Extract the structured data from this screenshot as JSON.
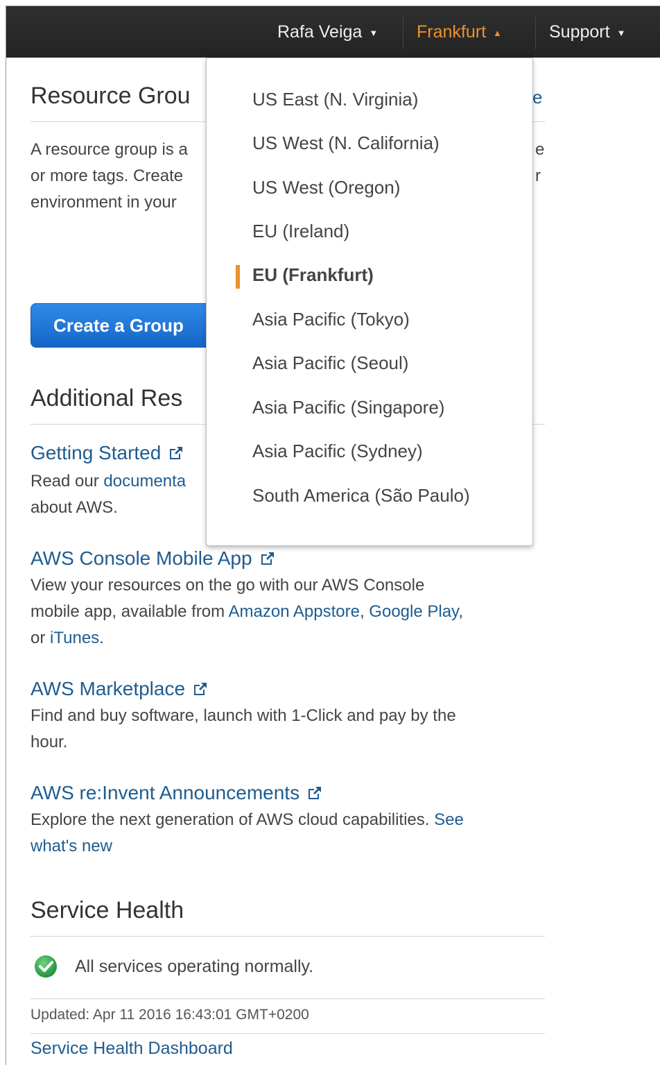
{
  "nav": {
    "user": "Rafa Veiga",
    "region": "Frankfurt",
    "support": "Support"
  },
  "resource_groups": {
    "title": "Resource Grou",
    "title_tail": "e",
    "desc_line1": "A resource group is a",
    "desc_line1_tail": "e",
    "desc_line2": "or more tags. Create",
    "desc_line2_tail": "r",
    "desc_line3": "environment in your",
    "create_button": "Create a Group"
  },
  "additional": {
    "title": "Additional Res",
    "items": [
      {
        "title": "Getting Started",
        "text_before": "Read our ",
        "link": "documenta",
        "line2": "about AWS."
      },
      {
        "title": "AWS Console Mobile App",
        "line1": "View your resources on the go with our AWS Console",
        "line2_prefix": "mobile app, available from ",
        "link1": "Amazon Appstore",
        "sep": ", ",
        "link2": "Google Play",
        "line2_suffix": ",",
        "line3_prefix": "or ",
        "link3": "iTunes",
        "line3_suffix": "."
      },
      {
        "title": "AWS Marketplace",
        "line1": "Find and buy software, launch with 1-Click and pay by the",
        "line2": "hour."
      },
      {
        "title": "AWS re:Invent Announcements",
        "line1_prefix": "Explore the next generation of AWS cloud capabilities. ",
        "link1": "See",
        "link2": "what's new"
      }
    ]
  },
  "service_health": {
    "title": "Service Health",
    "status": "All services operating normally.",
    "updated": "Updated: Apr 11 2016 16:43:01 GMT+0200",
    "dashboard_link": "Service Health Dashboard"
  },
  "regions": {
    "items": [
      "US East (N. Virginia)",
      "US West (N. California)",
      "US West (Oregon)",
      "EU (Ireland)",
      "EU (Frankfurt)",
      "Asia Pacific (Tokyo)",
      "Asia Pacific (Seoul)",
      "Asia Pacific (Singapore)",
      "Asia Pacific (Sydney)",
      "South America (São Paulo)"
    ],
    "selected": "EU (Frankfurt)"
  },
  "colors": {
    "accent": "#ec912d",
    "link": "#1f5c8f",
    "button": "#1f78d8",
    "ok": "#2fa84f"
  },
  "icons": {
    "external": "external-link-icon",
    "caret": "caret-down-icon",
    "status": "check-circle-icon"
  }
}
